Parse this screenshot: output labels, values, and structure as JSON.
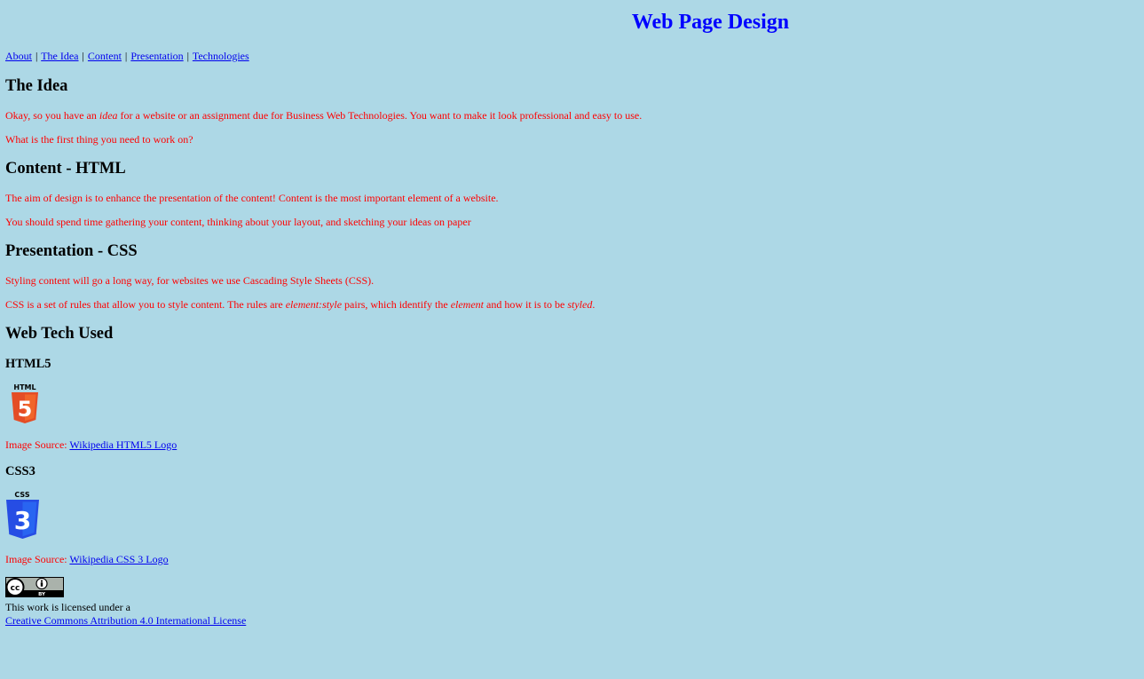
{
  "header": {
    "title": "Web Page Design"
  },
  "nav": {
    "items": [
      "About",
      "The Idea",
      "Content",
      "Presentation",
      "Technologies"
    ],
    "separator": "|"
  },
  "idea": {
    "heading": "The Idea",
    "p1_before": "Okay, so you have an ",
    "p1_em": "idea",
    "p1_after": " for a website or an assignment due for Business Web Technologies. You want to make it look professional and easy to use.",
    "p2": "What is the first thing you need to work on?"
  },
  "content": {
    "heading": "Content - HTML",
    "p1": "The aim of design is to enhance the presentation of the content! Content is the most important element of a website.",
    "p2": "You should spend time gathering your content, thinking about your layout, and sketching your ideas on paper"
  },
  "presentation": {
    "heading": "Presentation - CSS",
    "p1": "Styling content will go a long way, for websites we use Cascading Style Sheets (CSS).",
    "p2_a": "CSS is a set of rules that allow you to style content. The rules are ",
    "p2_em1": "element:style",
    "p2_b": " pairs, which identify the ",
    "p2_em2": "element",
    "p2_c": " and how it is to be ",
    "p2_em3": "styled",
    "p2_d": "."
  },
  "tech": {
    "heading": "Web Tech Used",
    "html5": {
      "heading": "HTML5",
      "logo_text": "HTML",
      "logo_digit": "5",
      "source_label": "Image Source: ",
      "source_link": "Wikipedia HTML5 Logo"
    },
    "css3": {
      "heading": "CSS3",
      "logo_text": "CSS",
      "logo_digit": "3",
      "source_label": "Image Source: ",
      "source_link": "Wikipedia CSS 3 Logo"
    }
  },
  "license": {
    "text": "This work is licensed under a",
    "link": "Creative Commons Attribution 4.0 International License"
  },
  "colors": {
    "background": "#add8e6",
    "title": "#0000ff",
    "body_text": "#ff0000",
    "link": "#0000ee",
    "html5_orange": "#e44d26",
    "css3_blue": "#264de4"
  },
  "icons": [
    "html5-logo-icon",
    "css3-logo-icon",
    "cc-by-license-icon"
  ]
}
